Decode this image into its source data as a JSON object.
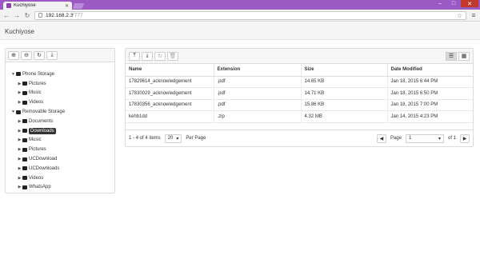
{
  "browser": {
    "tab_title": "Kuchiyose",
    "url_host": "192.168.2.3",
    "url_port": ":7777",
    "window_controls": [
      "minimize",
      "maximize",
      "close"
    ]
  },
  "app": {
    "title": "Kuchiyose"
  },
  "left_toolbar": {
    "buttons": [
      {
        "icon": "add-icon",
        "glyph": "⊕"
      },
      {
        "icon": "remove-icon",
        "glyph": "⊖"
      },
      {
        "icon": "refresh-icon",
        "glyph": "↻"
      },
      {
        "icon": "download-icon",
        "glyph": "⤓"
      }
    ]
  },
  "tree": {
    "phone": {
      "label": "Phone Storage",
      "children": [
        "Pictures",
        "Music",
        "Videos"
      ]
    },
    "removable": {
      "label": "Removable Storage",
      "children": [
        "Documents",
        "Downloads",
        "Music",
        "Pictures",
        "UCDownload",
        "UCDownloads",
        "Videos",
        "WhatsApp"
      ],
      "selected": "Downloads"
    }
  },
  "right_toolbar": {
    "buttons": [
      {
        "icon": "upload-icon",
        "glyph": "⤒"
      },
      {
        "icon": "download-icon",
        "glyph": "⤓"
      },
      {
        "icon": "refresh-icon",
        "glyph": "↻"
      },
      {
        "icon": "delete-icon",
        "glyph": "🗑"
      }
    ],
    "views": [
      {
        "icon": "list-view-icon",
        "glyph": "☰",
        "active": true
      },
      {
        "icon": "grid-view-icon",
        "glyph": "▦",
        "active": false
      }
    ]
  },
  "table": {
    "headers": [
      "Name",
      "Extension",
      "Size",
      "Date Modified"
    ],
    "rows": [
      [
        "17829614_acknowledgement",
        ".pdf",
        "14.65 KB",
        "Jan 18, 2015 6:44 PM"
      ],
      [
        "17830029_acknowledgement",
        ".pdf",
        "14.71 KB",
        "Jan 18, 2015 6:50 PM"
      ],
      [
        "17830356_acknowledgement",
        ".pdf",
        "15.86 KB",
        "Jan 18, 2015 7:00 PM"
      ],
      [
        "kehb1dd",
        ".zip",
        "4.32 MB",
        "Jan 14, 2015 4:23 PM"
      ]
    ]
  },
  "pager": {
    "range_text": "1 - 4 of 4 items",
    "page_size": "20",
    "per_page_label": "Per Page",
    "page_label": "Page",
    "page_value": "1",
    "of_text": "of 1"
  }
}
